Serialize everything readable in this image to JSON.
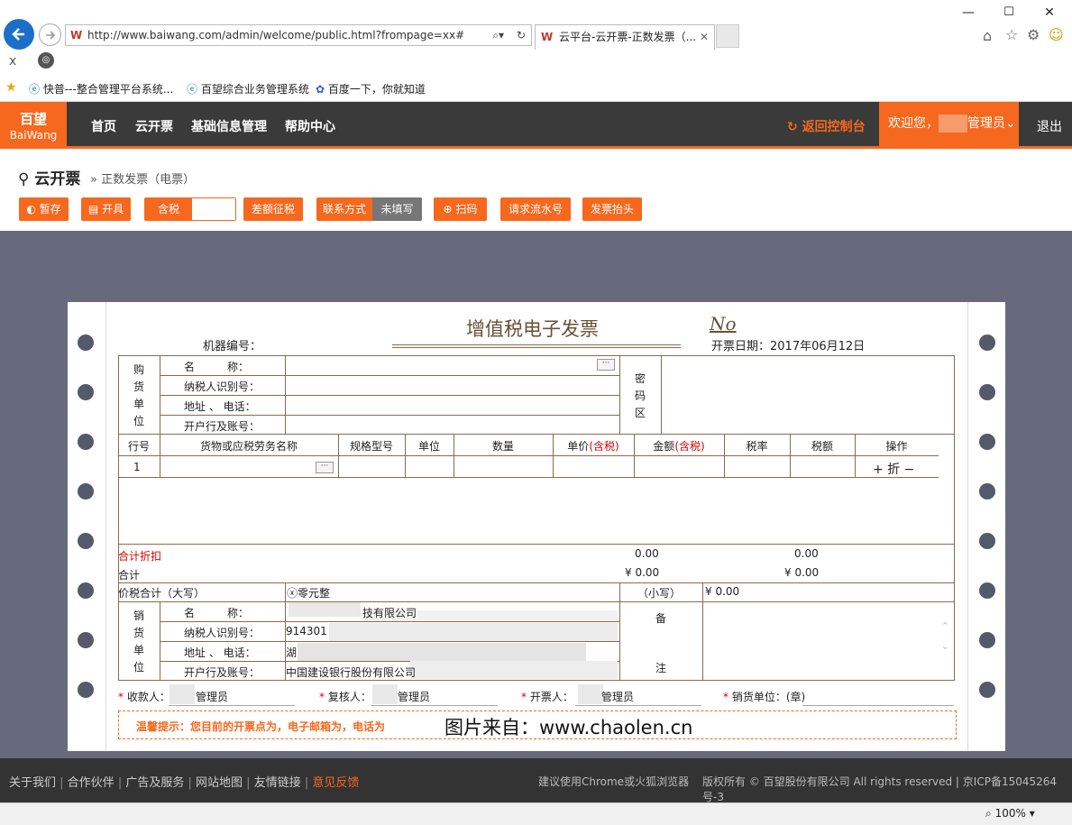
{
  "browser": {
    "url": "http://www.baiwang.com/admin/welcome/public.html?frompage=xx#",
    "tab_title": "云平台-云开票-正数发票（...",
    "favorites": [
      "快普---整合管理平台系统...",
      "百望综合业务管理系统",
      "百度一下，你就知道"
    ],
    "zoom": "100%"
  },
  "header": {
    "logo_cn": "百望",
    "logo_en": "BaiWang",
    "nav": [
      "首页",
      "云开票",
      "基础信息管理",
      "帮助中心"
    ],
    "return_label": "返回控制台",
    "welcome": "欢迎您，",
    "user_suffix": "管理员",
    "logout": "退出"
  },
  "breadcrumb": {
    "title": "云开票",
    "sub": "» 正数发票（电票）"
  },
  "toolbar": {
    "save": "暂存",
    "issue": "开具",
    "tax_incl": "含税",
    "diff_tax": "差额征税",
    "contact": "联系方式",
    "contact_status": "未填写",
    "scan": "扫码",
    "request_serial": "请求流水号",
    "invoice_header": "发票抬头"
  },
  "invoice": {
    "title": "增值税电子发票",
    "no_mark": "No",
    "machine_no_label": "机器编号：",
    "date_label": "开票日期：2017年06月12日",
    "buyer_block": "购货单位",
    "buyer_fields": [
      "名　　　称：",
      "纳税人识别号：",
      "地址 、 电话：",
      "开户行及账号："
    ],
    "cipher_block": "密码区",
    "columns": [
      "行号",
      "货物或应税劳务名称",
      "规格型号",
      "单位",
      "数量",
      "单价",
      "金额",
      "税率",
      "税额",
      "操作"
    ],
    "tax_tag": "(含税)",
    "row_no": "1",
    "row_ops": "+ 折 −",
    "discount_total_label": "合计折扣",
    "discount_amount": "0.00",
    "discount_tax": "0.00",
    "total_label": "合计",
    "total_amount": "¥ 0.00",
    "total_tax": "¥ 0.00",
    "grand_total_label": "价税合计（大写）",
    "grand_total_words": "ⓧ零元整",
    "small_label": "（小写）",
    "small_amount": "¥ 0.00",
    "seller_block": "销货单位",
    "seller_fields": [
      "名　　　称：",
      "纳税人识别号：",
      "地址 、 电话：",
      "开户行及账号："
    ],
    "seller_values": [
      "技有限公司",
      "914301",
      "湖",
      "中国建设银行股份有限公司"
    ],
    "remarks_block": "备注",
    "payee_label": "收款人：",
    "payee": "管理员",
    "reviewer_label": "复核人：",
    "reviewer": "管理员",
    "drawer_label": "开票人：",
    "drawer": "管理员",
    "seller_seal_label": "销货单位：(章)",
    "tip": "温馨提示：您目前的开票点为，电子邮箱为，电话为",
    "watermark": "图片来自：www.chaolen.cn"
  },
  "footer": {
    "links": [
      "关于我们",
      "合作伙伴",
      "广告及服务",
      "网站地图",
      "友情链接",
      "意见反馈"
    ],
    "browser_tip": "建议使用Chrome或火狐浏览器",
    "copyright": "版权所有 © 百望股份有限公司 All rights reserved | 京ICP备15045264号-3"
  }
}
